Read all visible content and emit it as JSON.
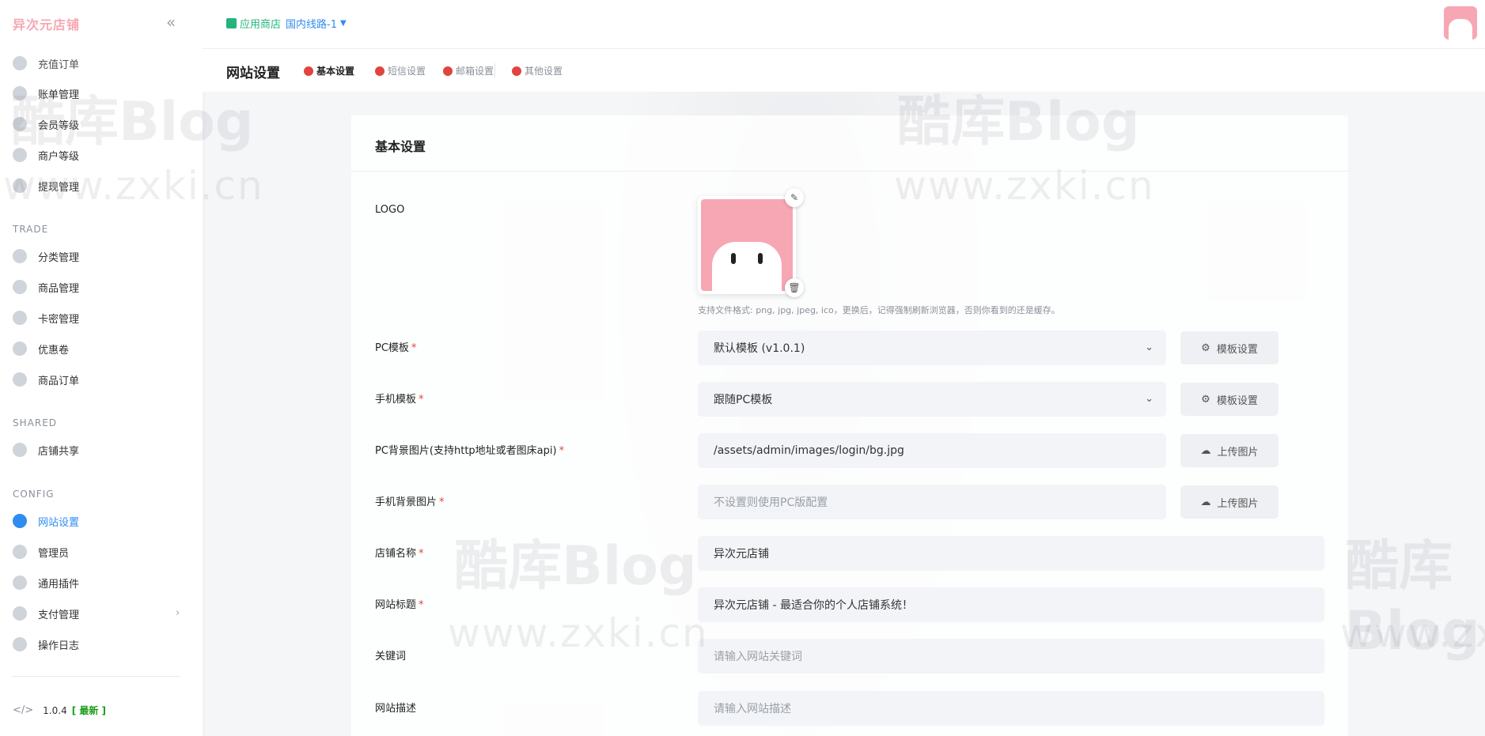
{
  "brand": {
    "name": "异次元店铺"
  },
  "sidebar": {
    "partial_item": "充值订单",
    "items_top": [
      "账单管理",
      "会员等级",
      "商户等级",
      "提现管理"
    ],
    "sections": {
      "trade": {
        "title": "TRADE",
        "items": [
          "分类管理",
          "商品管理",
          "卡密管理",
          "优惠卷",
          "商品订单"
        ]
      },
      "shared": {
        "title": "SHARED",
        "items": [
          "店铺共享"
        ]
      },
      "config": {
        "title": "CONFIG",
        "items": [
          "网站设置",
          "管理员",
          "通用插件",
          "支付管理",
          "操作日志"
        ]
      }
    },
    "active_item": "网站设置",
    "version": {
      "number": "1.0.4",
      "status": "[ 最新 ]"
    }
  },
  "topbar": {
    "store_label": "应用商店",
    "line_label": "国内线路-1"
  },
  "page": {
    "title": "网站设置",
    "tabs": [
      "基本设置",
      "短信设置",
      "邮箱设置",
      "其他设置"
    ]
  },
  "card": {
    "title": "基本设置",
    "logo_label": "LOGO",
    "logo_hint": "支持文件格式: png, jpg, jpeg, ico，更换后，记得强制刷新浏览器，否则你看到的还是缓存。",
    "fields": {
      "pc_template": {
        "label": "PC模板",
        "value": "默认模板 (v1.0.1)",
        "button": "模板设置"
      },
      "mobile_template": {
        "label": "手机模板",
        "value": "跟随PC模板",
        "button": "模板设置"
      },
      "pc_bg": {
        "label": "PC背景图片(支持http地址或者图床api)",
        "value": "/assets/admin/images/login/bg.jpg",
        "button": "上传图片"
      },
      "mobile_bg": {
        "label": "手机背景图片",
        "placeholder": "不设置则使用PC版配置",
        "button": "上传图片"
      },
      "shop_name": {
        "label": "店铺名称",
        "value": "异次元店铺"
      },
      "site_title": {
        "label": "网站标题",
        "value": "异次元店铺 - 最适合你的个人店铺系统！"
      },
      "keywords": {
        "label": "关键词",
        "placeholder": "请输入网站关键词"
      },
      "description": {
        "label": "网站描述",
        "placeholder": "请输入网站描述"
      }
    }
  },
  "watermark": {
    "title": "酷库Blog",
    "url": "www.zxki.cn"
  },
  "colors": {
    "accent": "#2f8cf0",
    "brand_pink": "#f7a7b3",
    "required": "#e0443e",
    "store_green": "#24b47e"
  }
}
